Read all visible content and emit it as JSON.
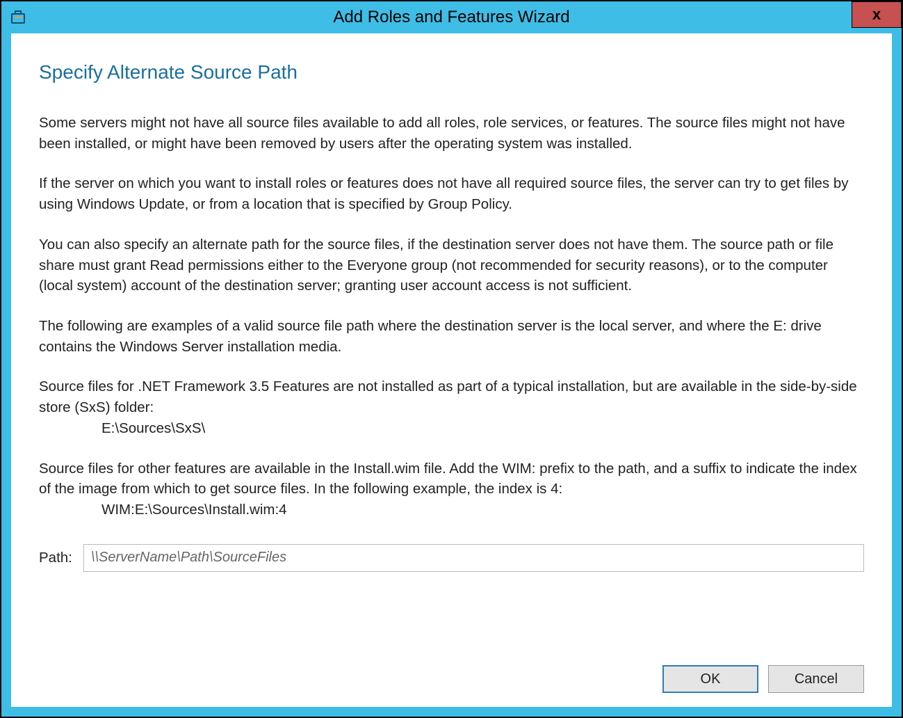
{
  "titlebar": {
    "title": "Add Roles and Features Wizard",
    "close_label": "x"
  },
  "page": {
    "heading": "Specify Alternate Source Path"
  },
  "body": {
    "para1": "Some servers might not have all source files available to add all roles, role services, or features. The source files might not have been installed, or might have been removed by users after the operating system was installed.",
    "para2": "If the server on which you want to install roles or features does not have all required source files, the server can try to get files by using Windows Update, or from a location that is specified by Group Policy.",
    "para3": "You can also specify an alternate path for the source files, if the destination server does not have them. The source path or file share must grant Read permissions either to the Everyone group (not recommended for security reasons), or to the computer (local system) account of the destination server; granting user account access is not sufficient.",
    "para4": "The following are examples of a valid source file path where the destination server is the local server, and where the E: drive contains the Windows Server installation media.",
    "para5_intro": "Source files for .NET Framework 3.5 Features are not installed as part of a typical installation, but are available in the side-by-side store (SxS) folder:",
    "para5_path": "E:\\Sources\\SxS\\",
    "para6_intro": "Source files for other features are available in the Install.wim file. Add the WIM: prefix to the path, and a suffix to indicate the index of the image from which to get source files. In the following example, the index is 4:",
    "para6_path": "WIM:E:\\Sources\\Install.wim:4"
  },
  "path_field": {
    "label": "Path:",
    "placeholder": "\\\\ServerName\\Path\\SourceFiles",
    "value": ""
  },
  "buttons": {
    "ok": "OK",
    "cancel": "Cancel"
  }
}
